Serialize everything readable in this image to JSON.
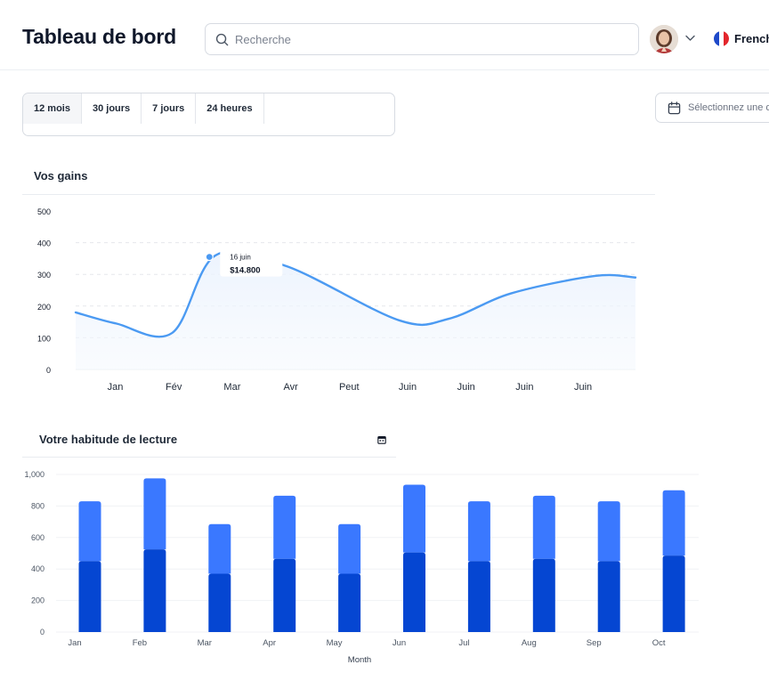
{
  "header": {
    "title": "Tableau de bord",
    "search_placeholder": "Recherche",
    "language": "French"
  },
  "filters": {
    "period_tabs": [
      "12 mois",
      "30 jours",
      "7 jours",
      "24 heures"
    ],
    "active_tab": "12 mois",
    "date_picker_label": "Sélectionnez une d"
  },
  "earnings": {
    "title": "Vos gains",
    "tooltip": {
      "date": "16 juin",
      "value": "$14.800"
    }
  },
  "reading": {
    "title": "Votre habitude de lecture"
  },
  "colors": {
    "line": "#4b9af2",
    "bar_light": "#3a78ff",
    "bar_dark": "#0546d2"
  },
  "chart_data": [
    {
      "type": "area",
      "title": "Vos gains",
      "categories": [
        "Jan",
        "Fév",
        "Mar",
        "Avr",
        "Peut",
        "Juin",
        "Juin",
        "Juin",
        "Juin"
      ],
      "y_ticks": [
        0,
        100,
        200,
        300,
        400,
        500
      ],
      "ylim": [
        0,
        500
      ],
      "points": [
        {
          "x": 0.0,
          "y": 180
        },
        {
          "x": 0.65,
          "y": 145
        },
        {
          "x": 1.55,
          "y": 115
        },
        {
          "x": 2.25,
          "y": 360
        },
        {
          "x": 3.4,
          "y": 325
        },
        {
          "x": 5.2,
          "y": 155
        },
        {
          "x": 6.0,
          "y": 160
        },
        {
          "x": 7.0,
          "y": 240
        },
        {
          "x": 8.35,
          "y": 295
        },
        {
          "x": 9.0,
          "y": 290
        }
      ],
      "highlight": {
        "x": 2.15,
        "y": 355
      },
      "grid": true
    },
    {
      "type": "bar",
      "title": "Votre habitude de lecture",
      "xlabel": "Month",
      "categories": [
        "Jan",
        "Feb",
        "Mar",
        "Apr",
        "May",
        "Jun",
        "Jul",
        "Aug",
        "Sep",
        "Oct"
      ],
      "y_ticks": [
        "0",
        "200",
        "400",
        "600",
        "800",
        "1,000"
      ],
      "ylim": [
        0,
        1000
      ],
      "series": [
        {
          "values": [
            450,
            525,
            370,
            465,
            370,
            505,
            450,
            465,
            450,
            485
          ]
        },
        {
          "values": [
            830,
            975,
            685,
            865,
            685,
            935,
            830,
            865,
            830,
            900
          ]
        }
      ],
      "grid": true
    }
  ]
}
